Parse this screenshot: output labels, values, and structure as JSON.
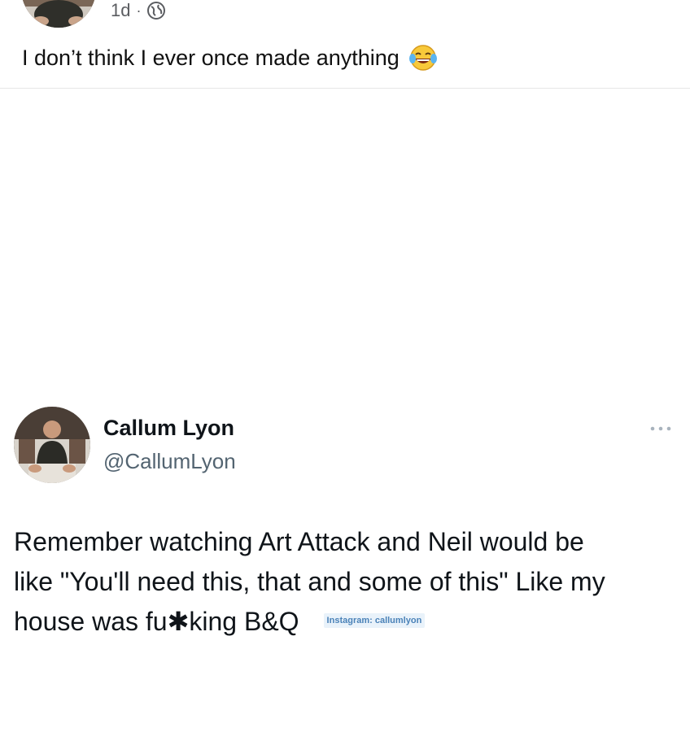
{
  "top_post": {
    "time": "1d",
    "separator": "·",
    "privacy_icon": "globe-icon",
    "text": "I don’t think I ever once made anything",
    "emoji_icon": "laughing-tears-emoji"
  },
  "tweet": {
    "display_name": "Callum Lyon",
    "handle": "@CallumLyon",
    "more_icon": "more-options-icon",
    "body_line_1": "Remember watching Art Attack and Neil would be",
    "body_line_2": "like \"You'll need this, that and some of this\" Like my",
    "body_line_3_prefix": "house was fu",
    "body_censor": "✱",
    "body_line_3_suffix": "king B&Q",
    "watermark": "Instagram: callumlyon"
  },
  "colors": {
    "text": "#111111",
    "secondary": "#536471",
    "divider": "#e6e6e6",
    "watermark_bg": "#e9f2fa",
    "watermark_text": "#4a82b8"
  }
}
